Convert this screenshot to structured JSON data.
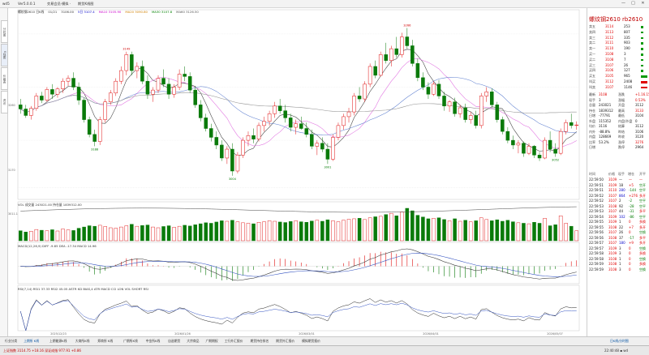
{
  "window": {
    "title_parts": [
      "wd5",
      "Ver5.0.0.1",
      "交易会员·模拟 ·",
      "期货K线图"
    ],
    "controls": [
      "—",
      "□",
      "✕"
    ]
  },
  "left_tabs": [
    "分时图",
    "K线图",
    "价格表",
    "资讯"
  ],
  "chart": {
    "main_info": "螺纹钢2610 日K线  01/21  3106.00  5日 3107.4  MA10 3105.90  MA20 3090.80  MA30 3107.8  MA60 3126.50",
    "main_info_colors": [
      "#333333",
      "#0000c8",
      "#cc00cc",
      "#d08000",
      "#008000",
      "#555555"
    ],
    "price_labels": [
      "3260",
      "3170"
    ],
    "annotations": [
      {
        "text": "3149",
        "i": 20,
        "at": "high"
      },
      {
        "text": "3188",
        "i": 14,
        "at": "low"
      },
      {
        "text": "3004",
        "i": 40,
        "at": "low"
      },
      {
        "text": "3001",
        "i": 58,
        "at": "low"
      },
      {
        "text": "3266",
        "i": 73,
        "at": "high"
      },
      {
        "text": "3052",
        "i": 101,
        "at": "low"
      }
    ],
    "vol_info": "VOL  成交量 243021.00  持仓量 1839312.00",
    "vol_label": "3011.1",
    "macd_info": "MACD(12,26,9)  DIFF -9.85  DEA -17.34  MACD 14.96",
    "kdj_info": "RSI(7,14)  RSI1 37.33  RSI2 45.05        ASTR  KD  BIAS,4  ATR  MACD  CCI  LON  VOL  SHORT  RSI",
    "dates": [
      "2025/12/23",
      "2026/01/26",
      "2026/03/01",
      "2026/04/01",
      "2026/05/07"
    ],
    "colors": {
      "up": "#e01010",
      "down": "#0a7a0a",
      "ma5": "#3a3a3a",
      "ma10": "#e070e0",
      "ma20": "#6080d0",
      "ma60": "#909090"
    }
  },
  "chart_data": {
    "type": "candlestick",
    "title": "螺纹钢2610 日K线",
    "ylim": [
      2980,
      3290
    ],
    "candles": [
      [
        3140,
        3150,
        3125,
        3133
      ],
      [
        3133,
        3140,
        3118,
        3122
      ],
      [
        3122,
        3138,
        3115,
        3134
      ],
      [
        3134,
        3160,
        3130,
        3155
      ],
      [
        3155,
        3162,
        3143,
        3148
      ],
      [
        3148,
        3170,
        3145,
        3166
      ],
      [
        3166,
        3175,
        3150,
        3158
      ],
      [
        3158,
        3170,
        3152,
        3167
      ],
      [
        3167,
        3185,
        3160,
        3180
      ],
      [
        3180,
        3190,
        3172,
        3185
      ],
      [
        3185,
        3195,
        3165,
        3170
      ],
      [
        3170,
        3178,
        3140,
        3148
      ],
      [
        3148,
        3152,
        3110,
        3115
      ],
      [
        3115,
        3120,
        3085,
        3090
      ],
      [
        3090,
        3098,
        3070,
        3078
      ],
      [
        3078,
        3120,
        3072,
        3115
      ],
      [
        3115,
        3150,
        3110,
        3145
      ],
      [
        3145,
        3165,
        3140,
        3160
      ],
      [
        3160,
        3185,
        3155,
        3180
      ],
      [
        3180,
        3205,
        3175,
        3198
      ],
      [
        3198,
        3230,
        3190,
        3225
      ],
      [
        3225,
        3230,
        3190,
        3198
      ],
      [
        3198,
        3212,
        3185,
        3205
      ],
      [
        3205,
        3215,
        3175,
        3180
      ],
      [
        3180,
        3190,
        3150,
        3158
      ],
      [
        3158,
        3170,
        3145,
        3165
      ],
      [
        3165,
        3190,
        3160,
        3185
      ],
      [
        3185,
        3200,
        3170,
        3175
      ],
      [
        3175,
        3185,
        3150,
        3158
      ],
      [
        3158,
        3175,
        3152,
        3170
      ],
      [
        3170,
        3200,
        3165,
        3192
      ],
      [
        3192,
        3205,
        3180,
        3188
      ],
      [
        3188,
        3195,
        3160,
        3165
      ],
      [
        3165,
        3172,
        3135,
        3140
      ],
      [
        3140,
        3148,
        3112,
        3118
      ],
      [
        3118,
        3125,
        3095,
        3100
      ],
      [
        3100,
        3108,
        3078,
        3085
      ],
      [
        3085,
        3095,
        3065,
        3072
      ],
      [
        3072,
        3080,
        3045,
        3050
      ],
      [
        3050,
        3070,
        3040,
        3065
      ],
      [
        3065,
        3075,
        3020,
        3028
      ],
      [
        3028,
        3060,
        3024,
        3055
      ],
      [
        3055,
        3085,
        3050,
        3080
      ],
      [
        3080,
        3095,
        3070,
        3088
      ],
      [
        3088,
        3100,
        3075,
        3082
      ],
      [
        3082,
        3110,
        3078,
        3105
      ],
      [
        3105,
        3120,
        3095,
        3112
      ],
      [
        3112,
        3130,
        3105,
        3125
      ],
      [
        3125,
        3145,
        3118,
        3138
      ],
      [
        3138,
        3150,
        3125,
        3130
      ],
      [
        3130,
        3140,
        3110,
        3118
      ],
      [
        3118,
        3125,
        3095,
        3102
      ],
      [
        3102,
        3115,
        3090,
        3108
      ],
      [
        3108,
        3120,
        3098,
        3100
      ],
      [
        3100,
        3110,
        3085,
        3090
      ],
      [
        3090,
        3098,
        3065,
        3070
      ],
      [
        3070,
        3080,
        3055,
        3075
      ],
      [
        3075,
        3085,
        3060,
        3065
      ],
      [
        3065,
        3075,
        3040,
        3048
      ],
      [
        3048,
        3090,
        3045,
        3085
      ],
      [
        3085,
        3110,
        3080,
        3105
      ],
      [
        3105,
        3125,
        3098,
        3120
      ],
      [
        3120,
        3135,
        3110,
        3128
      ],
      [
        3128,
        3160,
        3122,
        3155
      ],
      [
        3155,
        3170,
        3145,
        3150
      ],
      [
        3150,
        3180,
        3145,
        3175
      ],
      [
        3175,
        3210,
        3170,
        3205
      ],
      [
        3205,
        3215,
        3185,
        3190
      ],
      [
        3190,
        3230,
        3188,
        3225
      ],
      [
        3225,
        3245,
        3210,
        3215
      ],
      [
        3215,
        3240,
        3205,
        3235
      ],
      [
        3235,
        3255,
        3220,
        3225
      ],
      [
        3225,
        3262,
        3220,
        3255
      ],
      [
        3255,
        3270,
        3235,
        3240
      ],
      [
        3240,
        3250,
        3205,
        3210
      ],
      [
        3210,
        3218,
        3180,
        3186
      ],
      [
        3186,
        3195,
        3165,
        3170
      ],
      [
        3170,
        3178,
        3150,
        3158
      ],
      [
        3158,
        3180,
        3155,
        3175
      ],
      [
        3175,
        3182,
        3150,
        3155
      ],
      [
        3155,
        3162,
        3130,
        3138
      ],
      [
        3138,
        3148,
        3128,
        3145
      ],
      [
        3145,
        3152,
        3120,
        3125
      ],
      [
        3125,
        3140,
        3118,
        3135
      ],
      [
        3135,
        3142,
        3110,
        3115
      ],
      [
        3115,
        3128,
        3108,
        3122
      ],
      [
        3122,
        3130,
        3100,
        3105
      ],
      [
        3105,
        3160,
        3100,
        3155
      ],
      [
        3155,
        3170,
        3145,
        3162
      ],
      [
        3162,
        3168,
        3135,
        3140
      ],
      [
        3140,
        3145,
        3110,
        3115
      ],
      [
        3115,
        3120,
        3090,
        3095
      ],
      [
        3095,
        3102,
        3075,
        3080
      ],
      [
        3080,
        3088,
        3065,
        3072
      ],
      [
        3072,
        3080,
        3058,
        3075
      ],
      [
        3075,
        3078,
        3052,
        3058
      ],
      [
        3058,
        3075,
        3055,
        3070
      ],
      [
        3070,
        3072,
        3050,
        3055
      ],
      [
        3055,
        3060,
        3045,
        3050
      ],
      [
        3050,
        3085,
        3048,
        3080
      ],
      [
        3080,
        3095,
        3060,
        3065
      ],
      [
        3065,
        3075,
        3052,
        3058
      ],
      [
        3058,
        3100,
        3055,
        3095
      ],
      [
        3095,
        3115,
        3090,
        3110
      ],
      [
        3110,
        3125,
        3100,
        3105
      ],
      [
        3105,
        3112,
        3098,
        3106
      ]
    ],
    "volumes": [
      40,
      35,
      38,
      45,
      42,
      40,
      44,
      39,
      47,
      43,
      41,
      50,
      55,
      60,
      58,
      62,
      57,
      52,
      50,
      55,
      60,
      66,
      58,
      61,
      63,
      55,
      52,
      57,
      60,
      54,
      58,
      62,
      59,
      64,
      68,
      72,
      70,
      75,
      80,
      78,
      82,
      76,
      72,
      70,
      68,
      74,
      76,
      80,
      78,
      75,
      73,
      77,
      80,
      76,
      74,
      79,
      82,
      78,
      84,
      80,
      76,
      82,
      86,
      88,
      90,
      85,
      92,
      96,
      98,
      105,
      110,
      100,
      115,
      130,
      120,
      102,
      95,
      88,
      90,
      92,
      85,
      80,
      88,
      78,
      82,
      76,
      80,
      92,
      85,
      80,
      84,
      78,
      82,
      76,
      72,
      70,
      68,
      74,
      70,
      90,
      60,
      64,
      100,
      70,
      58,
      40
    ],
    "vol_range": [
      0,
      130
    ]
  },
  "right_panel": {
    "title": "螺纹钢2610  rb2610",
    "orderbook": [
      {
        "label": "卖五",
        "price": "3114",
        "vol": "253"
      },
      {
        "label": "卖四",
        "price": "3113",
        "vol": "807"
      },
      {
        "label": "卖三",
        "price": "3112",
        "vol": "335"
      },
      {
        "label": "卖二",
        "price": "3111",
        "vol": "903"
      },
      {
        "label": "卖一",
        "price": "3110",
        "vol": "190"
      },
      {
        "label": "买一",
        "price": "3108",
        "vol": "3"
      },
      {
        "label": "买二",
        "price": "3108",
        "vol": "7"
      },
      {
        "label": "买三",
        "price": "3107",
        "vol": "26"
      },
      {
        "label": "买四",
        "price": "3106",
        "vol": "127"
      },
      {
        "label": "买五",
        "price": "3105",
        "vol": "965"
      },
      {
        "label": "叫买",
        "price": "3112",
        "vol": "2408"
      },
      {
        "label": "叫卖",
        "price": "3107",
        "vol": "1146"
      }
    ],
    "stats": [
      {
        "l1": "最新",
        "v1": "3108",
        "l2": "涨跌",
        "v2": "+1.16.15%"
      },
      {
        "l1": "现手",
        "v1": "3",
        "l2": "涨幅",
        "v2": "0.53%"
      },
      {
        "l1": "总量",
        "v1": "243021",
        "l2": "开盘",
        "v2": "3112"
      },
      {
        "l1": "持仓",
        "v1": "1839312",
        "l2": "最高",
        "v2": "3133"
      },
      {
        "l1": "日增",
        "v1": "-77791",
        "l2": "最低",
        "v2": "3104"
      },
      {
        "l1": "外盘",
        "v1": "115352",
        "l2": "内盘/外盘",
        "v2": "0"
      },
      {
        "l1": "均价",
        "v1": "3116",
        "l2": "结算",
        "v2": "3112"
      },
      {
        "l1": "内外",
        "v1": "-88.8%",
        "l2": "昨结",
        "v2": "3106"
      },
      {
        "l1": "内盘",
        "v1": "128669",
        "l2": "昨收",
        "v2": "3120"
      },
      {
        "l1": "比率",
        "v1": "53.2%",
        "l2": "涨停",
        "v2": "3276"
      },
      {
        "l1": "日增",
        "v1": "",
        "l2": "跌停",
        "v2": "2964"
      }
    ],
    "tick_header": [
      "时间",
      "价格",
      "现手",
      "增仓",
      "开平"
    ],
    "ticks": [
      {
        "t": "22:59:50",
        "p": "3109",
        "v": "—",
        "z": "—",
        "k": "—"
      },
      {
        "t": "22:59:51",
        "p": "3109",
        "v": "18",
        "z": "+5",
        "k": "空开"
      },
      {
        "t": "22:59:51",
        "p": "3110",
        "v": "280",
        "z": "-144",
        "k": "空平"
      },
      {
        "t": "22:59:52",
        "p": "3107",
        "v": "864",
        "z": "+276",
        "k": "多开"
      },
      {
        "t": "22:59:52",
        "p": "3107",
        "v": "2",
        "z": "-2",
        "k": "空平"
      },
      {
        "t": "22:59:53",
        "p": "3108",
        "v": "92",
        "z": "-28",
        "k": "空平"
      },
      {
        "t": "22:59:53",
        "p": "3107",
        "v": "44",
        "z": "-31",
        "k": "多平"
      },
      {
        "t": "22:59:54",
        "p": "3109",
        "v": "102",
        "z": "-86",
        "k": "空平"
      },
      {
        "t": "22:59:55",
        "p": "3109",
        "v": "1",
        "z": "0",
        "k": "多换"
      },
      {
        "t": "22:59:55",
        "p": "3108",
        "v": "22",
        "z": "+7",
        "k": "多开"
      },
      {
        "t": "22:59:56",
        "p": "3107",
        "v": "26",
        "z": "0",
        "k": "空换"
      },
      {
        "t": "22:59:56",
        "p": "3108",
        "v": "37",
        "z": "-17",
        "k": "多平"
      },
      {
        "t": "22:59:57",
        "p": "3107",
        "v": "180",
        "z": "+9",
        "k": "多开"
      },
      {
        "t": "22:59:57",
        "p": "3109",
        "v": "3",
        "z": "0",
        "k": "空换"
      },
      {
        "t": "22:59:58",
        "p": "3109",
        "v": "3",
        "z": "0",
        "k": "多换"
      },
      {
        "t": "22:59:58",
        "p": "3108",
        "v": "1",
        "z": "0",
        "k": "空换"
      },
      {
        "t": "22:59:59",
        "p": "3108",
        "v": "1",
        "z": "0",
        "k": "多换"
      },
      {
        "t": "22:59:59",
        "p": "3108",
        "v": "3",
        "z": "0",
        "k": "空换"
      }
    ]
  },
  "bottom_tabs": [
    "行业分类",
    "上期所 K线",
    "上期能源K线",
    "大商所K线",
    "郑商所 K线",
    "广期所K线",
    "中金所K线",
    "自选期货",
    "大宗商品",
    "广期期权",
    "工行外汇报价",
    "期货持仓排名",
    "期货外汇报价",
    "模拟期货报价"
  ],
  "bottom_right": "日K线/分时图",
  "status": {
    "left": "上证指数 3114.75  +18.16    深证成指 977.91  +0.86",
    "right": "22:40:48  ▪  wd"
  }
}
